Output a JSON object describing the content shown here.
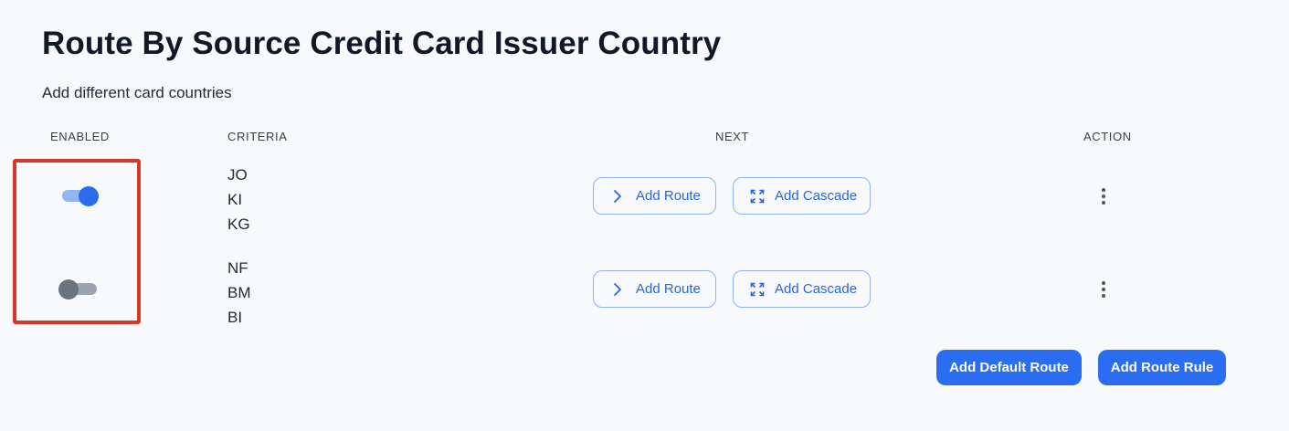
{
  "header": {
    "title": "Route By Source Credit Card Issuer Country",
    "subtitle": "Add different card countries"
  },
  "table": {
    "columns": [
      "ENABLED",
      "CRITERIA",
      "NEXT",
      "ACTION"
    ],
    "rows": [
      {
        "enabled": true,
        "criteria": [
          "JO",
          "KI",
          "KG"
        ],
        "add_route_label": "Add Route",
        "add_cascade_label": "Add Cascade"
      },
      {
        "enabled": false,
        "criteria": [
          "NF",
          "BM",
          "BI"
        ],
        "add_route_label": "Add Route",
        "add_cascade_label": "Add Cascade"
      }
    ]
  },
  "footer": {
    "add_default_route_label": "Add Default Route",
    "add_route_rule_label": "Add Route Rule"
  },
  "icons": {
    "route": "chevron-right-icon",
    "cascade": "expand-icon",
    "action": "more-vertical-icon"
  },
  "colors": {
    "accent": "#2b6df0",
    "toggle_on": "#2b6de9",
    "toggle_off": "#6b7280",
    "highlight": "#d33a23"
  }
}
